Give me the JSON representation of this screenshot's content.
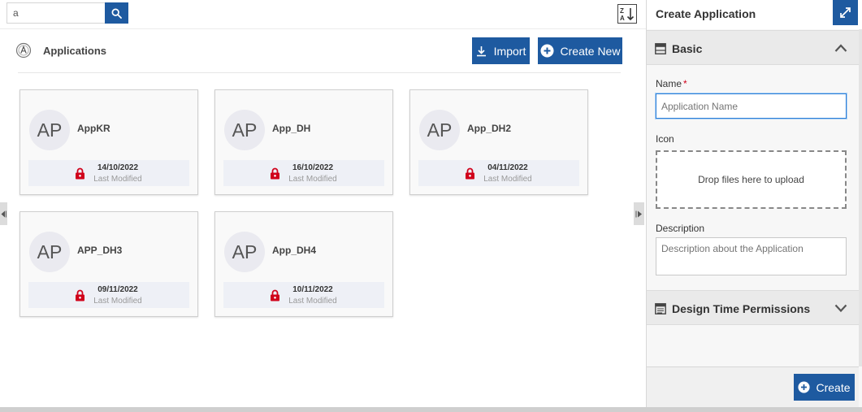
{
  "search": {
    "value": "a",
    "icon": "search-icon"
  },
  "sort": {
    "icon": "sort-z-a-icon"
  },
  "section": {
    "title": "Applications",
    "icon": "applications-icon"
  },
  "toolbar": {
    "import_label": "Import",
    "create_new_label": "Create New"
  },
  "cards": [
    {
      "initials": "AP",
      "name": "AppKR",
      "date": "14/10/2022",
      "modified_label": "Last Modified"
    },
    {
      "initials": "AP",
      "name": "App_DH",
      "date": "16/10/2022",
      "modified_label": "Last Modified"
    },
    {
      "initials": "AP",
      "name": "App_DH2",
      "date": "04/11/2022",
      "modified_label": "Last Modified"
    },
    {
      "initials": "AP",
      "name": "APP_DH3",
      "date": "09/11/2022",
      "modified_label": "Last Modified"
    },
    {
      "initials": "AP",
      "name": "App_DH4",
      "date": "10/11/2022",
      "modified_label": "Last Modified"
    }
  ],
  "panel": {
    "title": "Create Application",
    "basic_label": "Basic",
    "name_label": "Name",
    "name_required": "*",
    "name_placeholder": "Application Name",
    "icon_label": "Icon",
    "drop_text": "Drop files here to upload",
    "description_label": "Description",
    "description_placeholder": "Description about the Application",
    "permissions_label": "Design Time Permissions",
    "create_label": "Create"
  },
  "colors": {
    "primary": "#1e5aa0",
    "lock": "#d0021b",
    "focus": "#2d7ed6"
  }
}
